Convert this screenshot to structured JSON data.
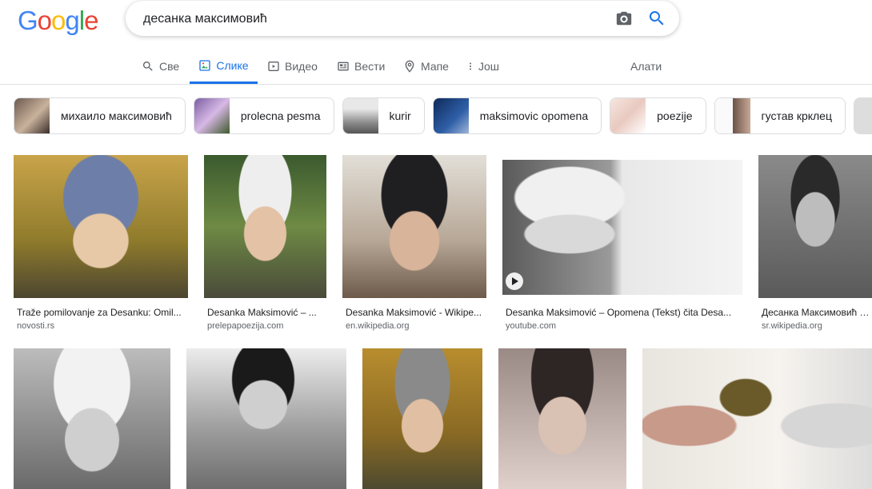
{
  "logo": {
    "g1": "G",
    "o1": "o",
    "o2": "o",
    "g2": "g",
    "l": "l",
    "e": "e"
  },
  "search": {
    "query": "десанка максимовић"
  },
  "tabs": [
    {
      "label": "Све",
      "icon": "search-icon"
    },
    {
      "label": "Слике",
      "icon": "image-icon"
    },
    {
      "label": "Видео",
      "icon": "video-icon"
    },
    {
      "label": "Вести",
      "icon": "news-icon"
    },
    {
      "label": "Мапе",
      "icon": "map-pin-icon"
    },
    {
      "label": "Још",
      "icon": "more-vert-icon"
    }
  ],
  "tools_label": "Алати",
  "chips": [
    {
      "label": "михаило максимовић"
    },
    {
      "label": "prolecna pesma"
    },
    {
      "label": "kurir"
    },
    {
      "label": "maksimovic opomena"
    },
    {
      "label": "poezije"
    },
    {
      "label": "густав крклец"
    }
  ],
  "results_row1": [
    {
      "caption": "Traže pomilovanje za Desanku: Omil...",
      "source": "novosti.rs"
    },
    {
      "caption": "Desanka Maksimović – ...",
      "source": "prelepapoezija.com"
    },
    {
      "caption": "Desanka Maksimović - Wikipe...",
      "source": "en.wikipedia.org"
    },
    {
      "caption": "Desanka Maksimović – Opomena (Tekst) čita Desa...",
      "source": "youtube.com"
    },
    {
      "caption": "Десанка Максимовић – ...",
      "source": "sr.wikipedia.org"
    }
  ],
  "colors": {
    "blue": "#4285F4",
    "red": "#EA4335",
    "yellow": "#FBBC05",
    "green": "#34A853",
    "active_tab": "#1a73e8"
  }
}
